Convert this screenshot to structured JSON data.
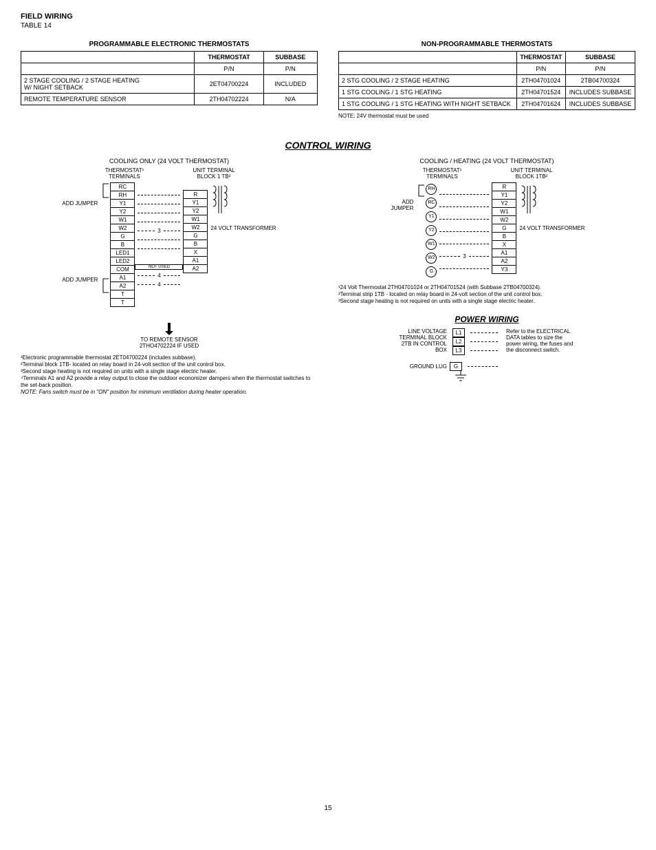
{
  "header": {
    "title": "FIELD WIRING",
    "sub": "TABLE 14"
  },
  "tableA": {
    "title": "PROGRAMMABLE ELECTRONIC THERMOSTATS",
    "headers": [
      "",
      "THERMOSTAT",
      "SUBBASE"
    ],
    "rows": [
      {
        "c0": "",
        "c1": "P/N",
        "c2": "P/N"
      },
      {
        "c0": "2 STAGE COOLING / 2 STAGE HEATING",
        "c1": "2ET04700224",
        "c2": "INCLUDED"
      },
      {
        "c0": "W/ NIGHT SETBACK",
        "c1": "",
        "c2": ""
      },
      {
        "c0": "REMOTE TEMPERATURE SENSOR",
        "c1": "2TH04702224",
        "c2": "N/A"
      }
    ]
  },
  "tableB": {
    "title": "NON-PROGRAMMABLE THERMOSTATS",
    "headers": [
      "",
      "THERMOSTAT",
      "SUBBASE"
    ],
    "rows": [
      {
        "c0": "",
        "c1": "P/N",
        "c2": "P/N"
      },
      {
        "c0": "2 STG COOLING / 2 STAGE HEATING",
        "c1": "2TH04701024",
        "c2": "2TB04700324"
      },
      {
        "c0": "1 STG COOLING / 1 STG HEATING",
        "c1": "2TH04701524",
        "c2": "INCLUDES SUBBASE"
      },
      {
        "c0": "1 STG COOLING / 1 STG HEATING WITH NIGHT SETBACK",
        "c1": "2TH04701624",
        "c2": "INCLUDES SUBBASE"
      }
    ],
    "note": "NOTE: 24V thermostat must be used"
  },
  "section": "CONTROL WIRING",
  "diagA": {
    "top": "COOLING ONLY (24 VOLT THERMOSTAT)",
    "leftHead": "THERMOSTAT¹ TERMINALS",
    "rightHead": "UNIT TERMINAL BLOCK 1 TB²",
    "add1": "ADD JUMPER",
    "add2": "ADD JUMPER",
    "leftTerms": [
      "RC",
      "RH",
      "Y1",
      "Y2",
      "W1",
      "W2",
      "G",
      "B",
      "LED1",
      "LED2",
      "COM",
      "A1",
      "A2",
      "T",
      "T"
    ],
    "rightTerms": [
      "R",
      "Y1",
      "Y2",
      "W1",
      "W2",
      "G",
      "B",
      "X",
      "A1",
      "A2"
    ],
    "notUsed": "NOT USED",
    "xfmr": "24 VOLT TRANSFORMER",
    "mark3": "3",
    "mark4": "4",
    "remote1": "TO REMOTE SENSOR",
    "remote2": "2THO4702224 IF USED",
    "foot": [
      "¹Electronic programmable thermostat 2ET04700224 (includes subbase).",
      "²Terminal block 1TB- located on relay board in 24-volt section of the unit control box.",
      "³Second stage heating is not required on units with a single stage electric heater.",
      "⁴Terminals A1 and A2 provide a relay output to close the outdoor economizer dampers when the thermostat switches to the set-back position."
    ],
    "note": "NOTE: Fans switch must be in \"ON\" position for minimum ventilation during heater operation."
  },
  "diagB": {
    "top": "COOLING / HEATING (24 VOLT THERMOSTAT)",
    "leftHead": "THERMOSTAT¹ TERMINALS",
    "rightHead": "UNIT TERMINAL BLOCK 1TB²",
    "add": "ADD JUMPER",
    "leftTerms": [
      "RH",
      "RC",
      "Y1",
      "Y2",
      "W1",
      "W2",
      "G"
    ],
    "rightTerms": [
      "R",
      "Y1",
      "Y2",
      "W1",
      "W2",
      "G",
      "B",
      "X",
      "A1",
      "A2",
      "Y3"
    ],
    "xfmr": "24 VOLT TRANSFORMER",
    "mark3": "3",
    "foot": [
      "¹24 Volt Thermostat 2TH04701024 or 2TH04701524 (with Subbase 2TB04700324).",
      "²Terminal strip 1TB - located on relay board in 24-volt section of the unit control box.",
      "³Second stage heating is not required on units with a single stage electric heater."
    ]
  },
  "power": {
    "title": "POWER  WIRING",
    "left": "LINE VOLTAGE TERMINAL BLOCK 2TB IN CONTROL BOX",
    "gnd": "GROUND LUG",
    "L": [
      "L1",
      "L2",
      "L3"
    ],
    "G": "G",
    "right": "Refer to the ELECTRICAL DATA tables to size the power wiring, the fuses and the disconnect switch."
  },
  "pageNo": "15"
}
